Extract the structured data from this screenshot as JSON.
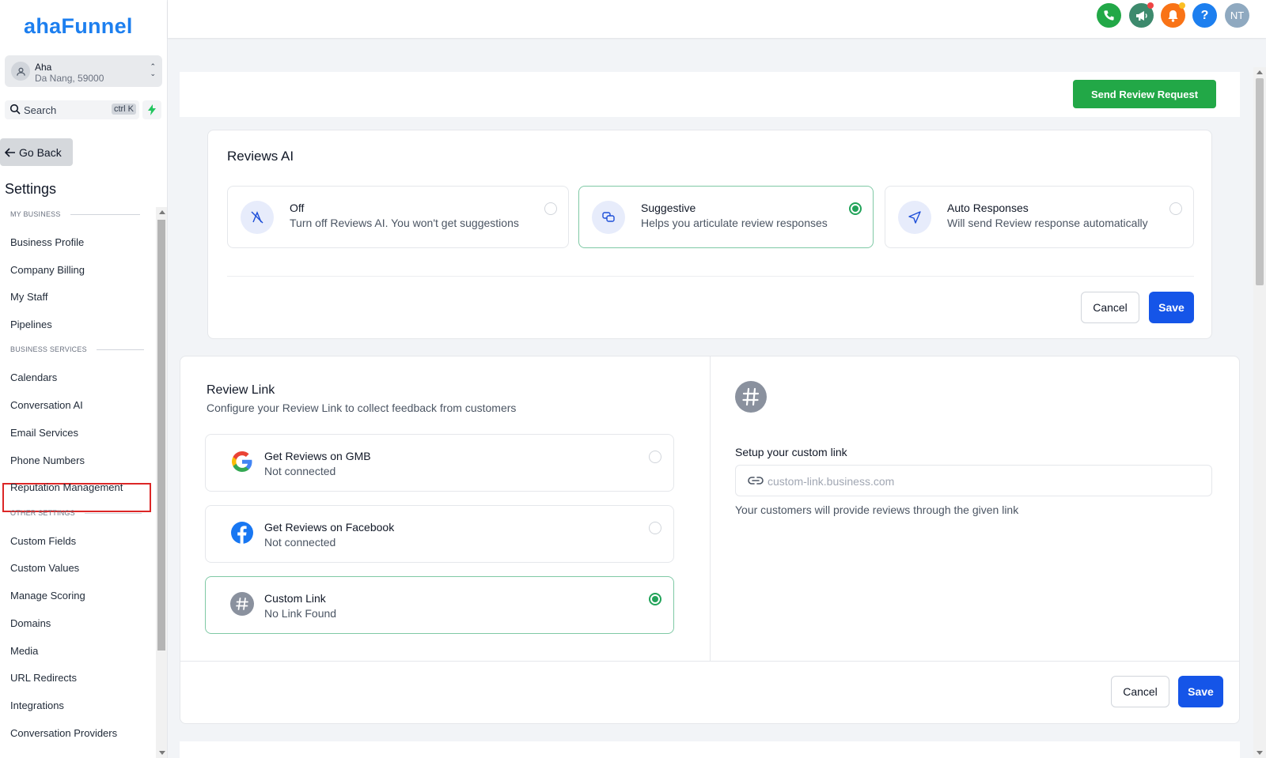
{
  "brand": {
    "logo": "ahaFunnel",
    "color": "#1d7fef"
  },
  "location": {
    "name": "Aha",
    "address": "Da Nang, 59000"
  },
  "search": {
    "label": "Search",
    "shortcut": "ctrl K"
  },
  "nav": {
    "go_back": "Go Back",
    "settings_title": "Settings",
    "sections": [
      {
        "label": "MY BUSINESS",
        "items": [
          "Business Profile",
          "Company Billing",
          "My Staff",
          "Pipelines"
        ]
      },
      {
        "label": "BUSINESS SERVICES",
        "items": [
          "Calendars",
          "Conversation AI",
          "Email Services",
          "Phone Numbers",
          "Reputation Management"
        ]
      },
      {
        "label": "OTHER SETTINGS",
        "items": [
          "Custom Fields",
          "Custom Values",
          "Manage Scoring",
          "Domains",
          "Media",
          "URL Redirects",
          "Integrations",
          "Conversation Providers"
        ]
      }
    ],
    "active_item": "Reputation Management"
  },
  "topbar": {
    "icons": [
      {
        "name": "phone-icon",
        "color": "#22a847"
      },
      {
        "name": "megaphone-icon",
        "color": "#3d8a6d",
        "badge": true
      },
      {
        "name": "bell-icon",
        "color": "#f97316",
        "badge": true
      },
      {
        "name": "help-icon",
        "color": "#1d7fef",
        "glyph": "?"
      },
      {
        "name": "avatar",
        "color": "#8fa9c0",
        "glyph": "NT"
      }
    ]
  },
  "header": {
    "send_review_request": "Send Review Request"
  },
  "reviews_ai": {
    "title": "Reviews AI",
    "options": [
      {
        "title": "Off",
        "desc": "Turn off Reviews AI. You won't get suggestions",
        "selected": false
      },
      {
        "title": "Suggestive",
        "desc": "Helps you articulate review responses",
        "selected": true
      },
      {
        "title": "Auto Responses",
        "desc": "Will send Review response automatically",
        "selected": false
      }
    ],
    "cancel": "Cancel",
    "save": "Save"
  },
  "review_link": {
    "title": "Review Link",
    "subtitle": "Configure your Review Link to collect feedback from customers",
    "options": [
      {
        "title": "Get Reviews on GMB",
        "status": "Not connected",
        "selected": false
      },
      {
        "title": "Get Reviews on Facebook",
        "status": "Not connected",
        "selected": false
      },
      {
        "title": "Custom Link",
        "status": "No Link Found",
        "selected": true
      }
    ],
    "custom_link_label": "Setup your custom link",
    "custom_link_placeholder": "custom-link.business.com",
    "custom_link_help": "Your customers will provide reviews through the given link",
    "cancel": "Cancel",
    "save": "Save"
  },
  "colors": {
    "primary": "#1555e8",
    "success": "#22a847",
    "selected_border": "#7fc9a5",
    "active_outline": "#dc2626"
  }
}
